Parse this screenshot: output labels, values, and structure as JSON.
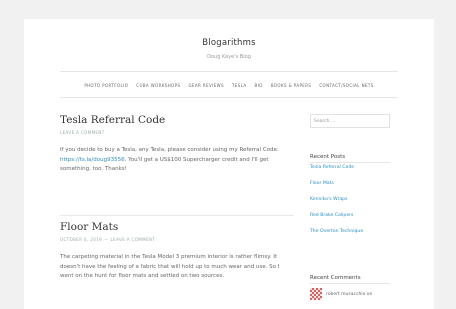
{
  "site": {
    "title": "Blogarithms",
    "description": "Doug Kaye's Blog"
  },
  "nav": [
    "PHOTO PORTFOLIO",
    "CUBA WORKSHOPS",
    "GEAR REVIEWS",
    "TESLA",
    "BIO",
    "BOOKS & PAPERS",
    "CONTACT/SOCIAL NETS"
  ],
  "posts": [
    {
      "title": "Tesla Referral Code",
      "meta_left": "",
      "meta_right": "LEAVE A COMMENT",
      "body_before_link": "If you decide to buy a Tesla, any Tesla, please consider using my Referral Code: ",
      "link": "https://ts.la/doug93556",
      "body_after_link": ". You'll get a US$100 Supercharger credit and I'll get something, too. Thanks!"
    },
    {
      "title": "Floor Mats",
      "meta_left": "OCTOBER 6, 2019",
      "meta_right": "LEAVE A COMMENT",
      "body": "The carpeting material in the Tesla Model 3 premium interior is rather flimsy. It doesn't have the feeling of a fabric that will hold up to much wear and use. So I went on the hunt for floor mats and settled on two sources."
    }
  ],
  "sidebar": {
    "search_placeholder": "Search …",
    "recent_posts_title": "Recent Posts",
    "recent_posts": [
      "Tesla Referral Code",
      "Floor Mats",
      "Kenniko's Wraps",
      "Red Brake Calipers",
      "The Overton Technique"
    ],
    "recent_comments_title": "Recent Comments",
    "comment_author": "robert musacchio on"
  }
}
